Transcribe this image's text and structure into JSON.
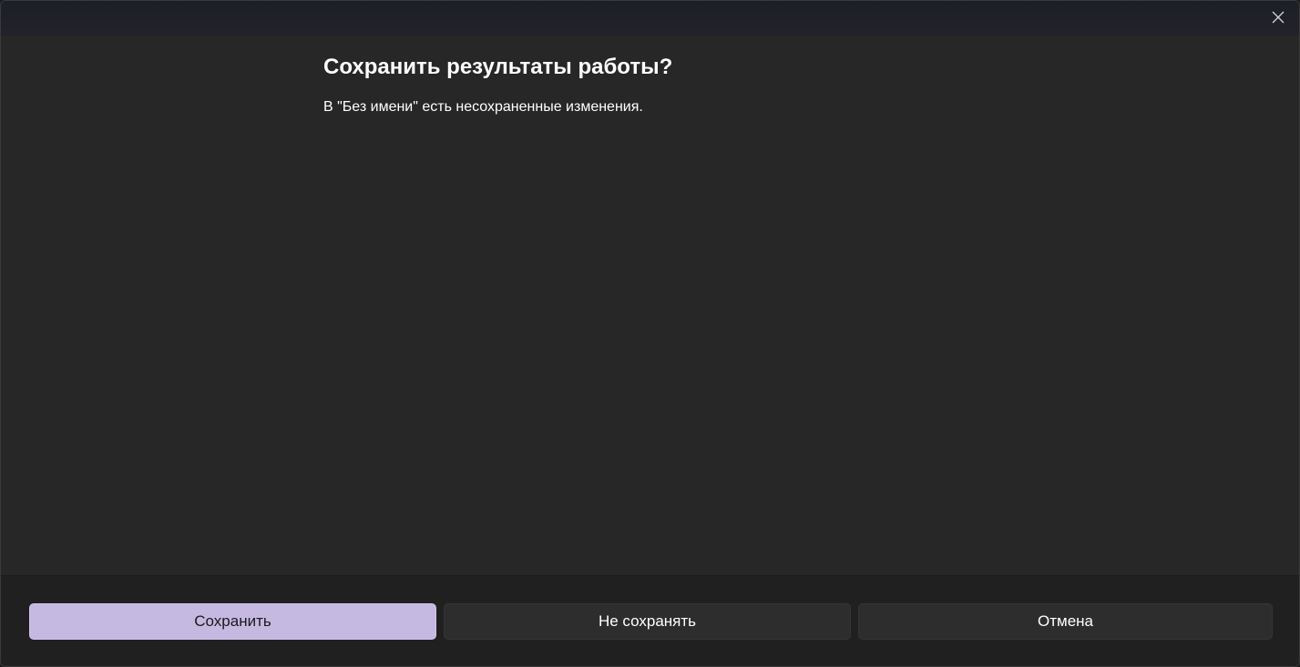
{
  "dialog": {
    "title": "Сохранить результаты работы?",
    "message": "В \"Без имени\" есть несохраненные изменения.",
    "close_icon": "close-icon"
  },
  "buttons": {
    "save_label": "Сохранить",
    "dont_save_label": "Не сохранять",
    "cancel_label": "Отмена"
  },
  "colors": {
    "primary_button_bg": "#c5b9e2",
    "dialog_bg": "#272727",
    "footer_bg": "#202020",
    "secondary_button_bg": "#2d2d2d",
    "text": "#ffffff"
  }
}
